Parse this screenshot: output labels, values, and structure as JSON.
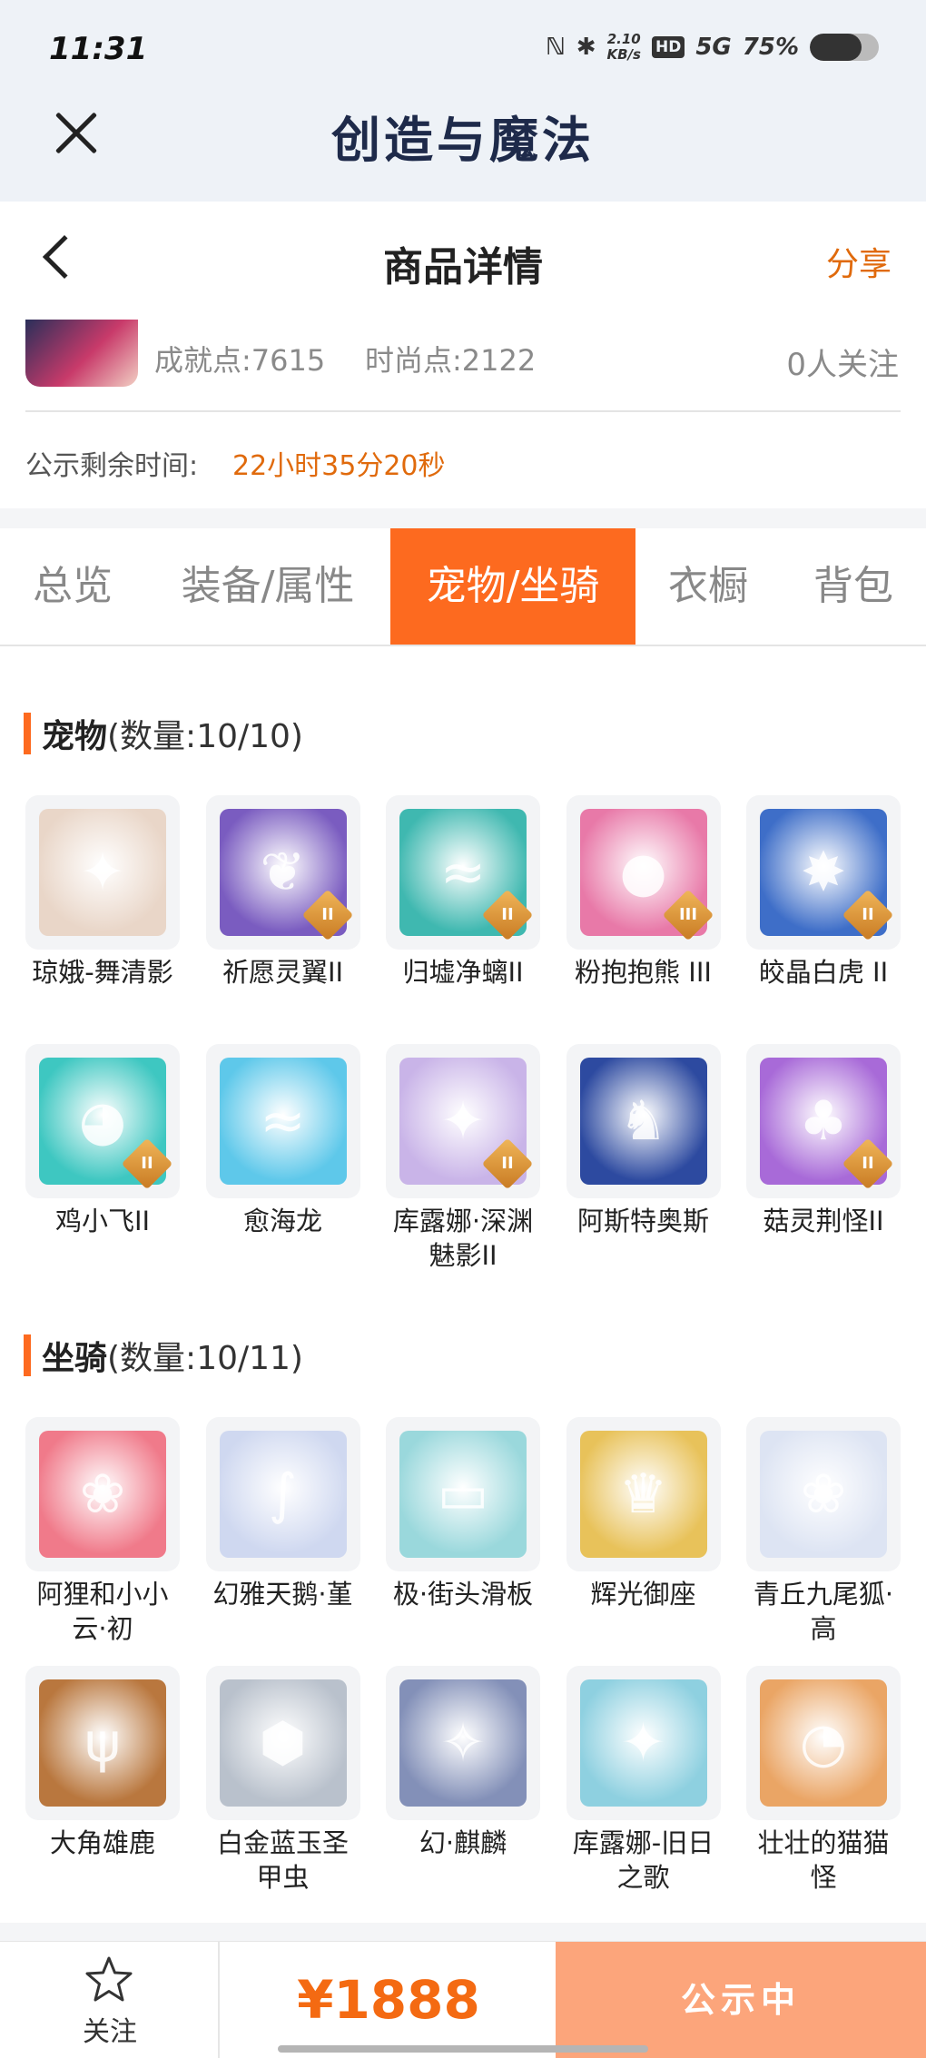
{
  "status_bar": {
    "time": "11:31",
    "network_speed": "2.10",
    "speed_unit": "KB/s",
    "hd": "HD",
    "signal": "5G",
    "battery": "75%",
    "battery_level": 0.75
  },
  "app": {
    "title": "创造与魔法"
  },
  "header": {
    "title": "商品详情",
    "share": "分享"
  },
  "profile": {
    "achievement": "成就点:7615",
    "fashion": "时尚点:2122",
    "followers": "0人关注",
    "notice_label": "公示剩余时间:",
    "notice_time": "22小时35分20秒"
  },
  "tabs": [
    {
      "label": "总览"
    },
    {
      "label": "装备/属性"
    },
    {
      "label": "宠物/坐骑",
      "active": true
    },
    {
      "label": "衣橱"
    },
    {
      "label": "背包"
    }
  ],
  "pets": {
    "title": "宠物",
    "count": "(数量:10/10)",
    "items": [
      {
        "name": "琼娥-舞清影",
        "color": "#e9d6c8",
        "icon": "pet-icon"
      },
      {
        "name": "祈愿灵翼II",
        "color": "#7a5cc0",
        "icon": "bird-icon",
        "tier": "II"
      },
      {
        "name": "归墟净螭II",
        "color": "#3fb8b0",
        "icon": "dragon-icon",
        "tier": "II"
      },
      {
        "name": "粉抱抱熊 III",
        "color": "#e879a8",
        "icon": "bear-icon",
        "tier": "III"
      },
      {
        "name": "皎晶白虎 II",
        "color": "#3e6ec8",
        "icon": "tiger-icon",
        "tier": "II"
      },
      {
        "name": "鸡小飞II",
        "color": "#3ec7c1",
        "icon": "chick-icon",
        "tier": "II"
      },
      {
        "name": "愈海龙",
        "color": "#5ec8ea",
        "icon": "dragon-icon"
      },
      {
        "name": "库露娜·深渊魅影II",
        "color": "#c9b4e8",
        "icon": "pet-icon",
        "tier": "II"
      },
      {
        "name": "阿斯特奥斯",
        "color": "#2d4aa0",
        "icon": "knight-icon"
      },
      {
        "name": "菇灵荆怪II",
        "color": "#a86ad8",
        "icon": "mushroom-icon",
        "tier": "II"
      }
    ]
  },
  "mounts": {
    "title": "坐骑",
    "count": "(数量:10/11)",
    "items": [
      {
        "name": "阿狸和小小云·初",
        "color": "#f07a8a",
        "icon": "fox-icon"
      },
      {
        "name": "幻雅天鹅·堇",
        "color": "#cfd8f0",
        "icon": "swan-icon"
      },
      {
        "name": "极·街头滑板",
        "color": "#9ad8dc",
        "icon": "skateboard-icon"
      },
      {
        "name": "辉光御座",
        "color": "#e8c25a",
        "icon": "throne-icon"
      },
      {
        "name": "青丘九尾狐·高",
        "color": "#dde4f3",
        "icon": "fox-icon"
      },
      {
        "name": "大角雄鹿",
        "color": "#b9773e",
        "icon": "deer-icon"
      },
      {
        "name": "白金蓝玉圣甲虫",
        "color": "#b9c1cc",
        "icon": "beetle-icon"
      },
      {
        "name": "幻·麒麟",
        "color": "#8390b8",
        "icon": "kirin-icon"
      },
      {
        "name": "库露娜-旧日之歌",
        "color": "#8ed0e0",
        "icon": "pet-icon"
      },
      {
        "name": "壮壮的猫猫怪",
        "color": "#eaa565",
        "icon": "cat-icon"
      }
    ]
  },
  "footer": {
    "follow": "关注",
    "price": "¥1888",
    "status": "公示中"
  },
  "colors": {
    "accent": "#fd6a1f",
    "price": "#f46a12",
    "status_button": "#fca57b",
    "notice": "#e06a0c"
  }
}
